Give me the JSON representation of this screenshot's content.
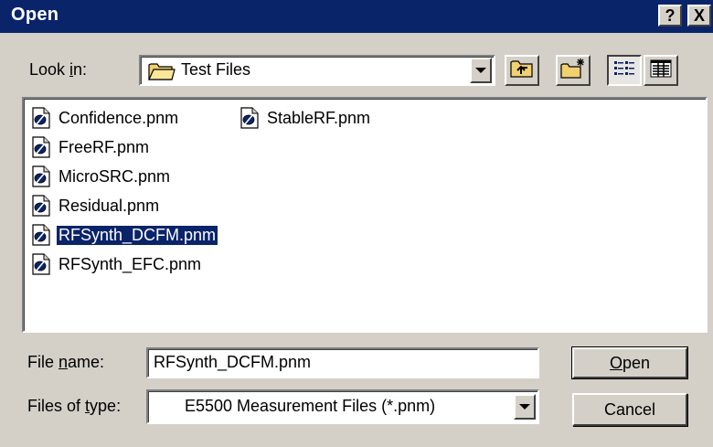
{
  "window": {
    "title": "Open",
    "help_label": "?",
    "close_label": "X"
  },
  "look_in": {
    "label_pre": "Look ",
    "label_accel": "i",
    "label_post": "n:",
    "value": "Test Files",
    "icon": "folder-icon"
  },
  "toolbar": [
    {
      "name": "up-one-level-button",
      "icon": "up-folder-icon"
    },
    {
      "name": "new-folder-button",
      "icon": "new-folder-icon"
    },
    {
      "name": "list-view-button",
      "icon": "list-view-icon",
      "pressed": true
    },
    {
      "name": "details-view-button",
      "icon": "details-view-icon",
      "pressed": false
    }
  ],
  "files": [
    {
      "name": "Confidence.pnm",
      "selected": false
    },
    {
      "name": "FreeRF.pnm",
      "selected": false
    },
    {
      "name": "MicroSRC.pnm",
      "selected": false
    },
    {
      "name": "Residual.pnm",
      "selected": false
    },
    {
      "name": "RFSynth_DCFM.pnm",
      "selected": true
    },
    {
      "name": "RFSynth_EFC.pnm",
      "selected": false
    },
    {
      "name": "StableRF.pnm",
      "selected": false
    }
  ],
  "file_name": {
    "label_pre": "File ",
    "label_accel": "n",
    "label_post": "ame:",
    "value": "RFSynth_DCFM.pnm"
  },
  "file_type": {
    "label_pre": "Files of ",
    "label_accel": "t",
    "label_post": "ype:",
    "value": "E5500 Measurement Files (*.pnm)"
  },
  "buttons": {
    "open_accel": "O",
    "open_rest": "pen",
    "cancel": "Cancel"
  },
  "colors": {
    "titlebar": "#0a246a",
    "face": "#d4d0c8",
    "selection": "#0a246a"
  }
}
